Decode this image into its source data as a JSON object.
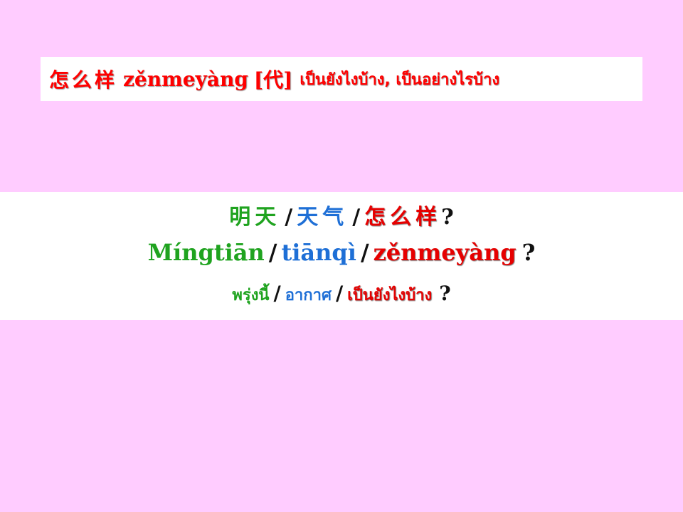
{
  "title": {
    "hanzi": "怎么样",
    "pinyin": "zěnmeyàng",
    "pos": "[代]",
    "thai": "เป็นยังไงบ้าง, เป็นอย่างไรบ้าง"
  },
  "example": {
    "separator": "/",
    "question_mark": "?",
    "hanzi": {
      "time": "明天",
      "subject": "天气",
      "predicate": "怎么样"
    },
    "pinyin": {
      "time": "Míngtiān",
      "subject": "tiānqì",
      "predicate": "zěnmeyàng"
    },
    "thai": {
      "time": "พรุ่งนี้",
      "subject": "อากาศ",
      "predicate": "เป็นยังไงบ้าง"
    }
  },
  "colors": {
    "background": "#ffccff",
    "time": "#1fa31f",
    "subject": "#1e6fd6",
    "predicate": "#e60000"
  }
}
